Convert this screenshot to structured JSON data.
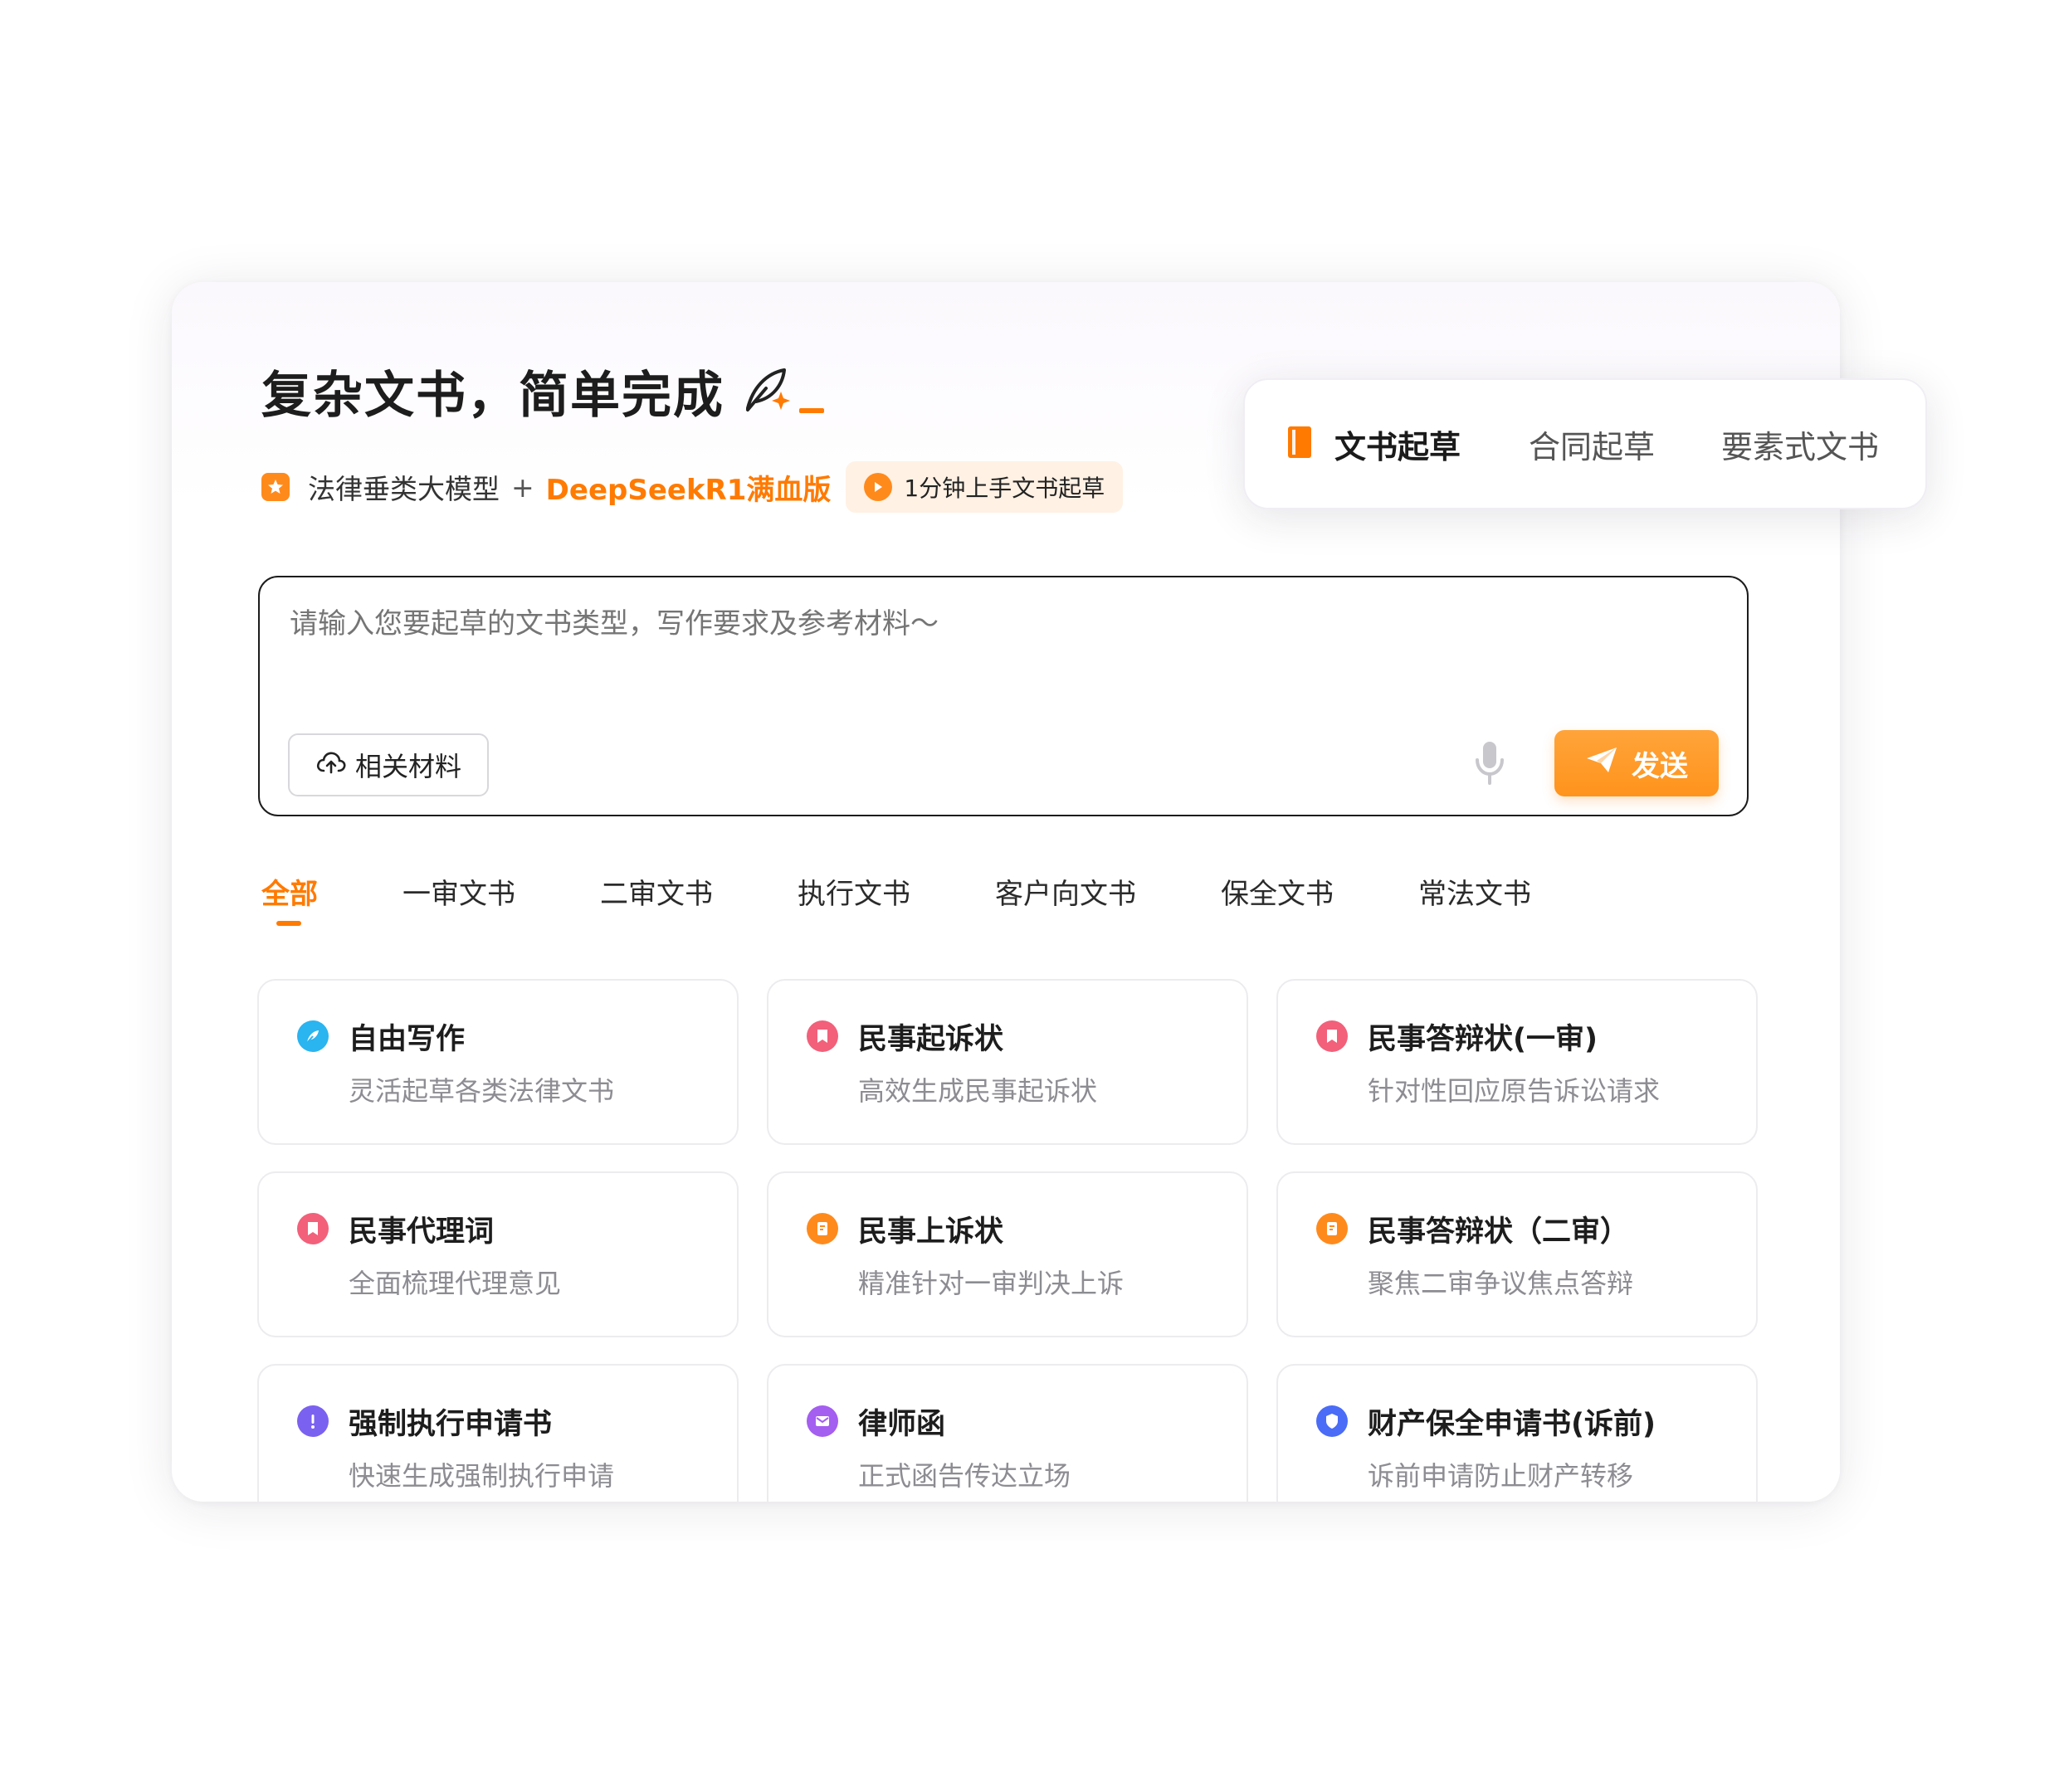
{
  "header": {
    "title": "复杂文书，简单完成",
    "model_label": "法律垂类大模型",
    "plus": "+",
    "deepseek_label": "DeepSeekR1满血版",
    "quick_start": "1分钟上手文书起草"
  },
  "mode_tabs": [
    {
      "label": "文书起草",
      "active": true
    },
    {
      "label": "合同起草",
      "active": false
    },
    {
      "label": "要素式文书",
      "active": false
    }
  ],
  "input": {
    "placeholder": "请输入您要起草的文书类型，写作要求及参考材料～",
    "material_button": "相关材料",
    "send_button": "发送"
  },
  "category_tabs": [
    {
      "label": "全部",
      "active": true
    },
    {
      "label": "一审文书",
      "active": false
    },
    {
      "label": "二审文书",
      "active": false
    },
    {
      "label": "执行文书",
      "active": false
    },
    {
      "label": "客户向文书",
      "active": false
    },
    {
      "label": "保全文书",
      "active": false
    },
    {
      "label": "常法文书",
      "active": false
    }
  ],
  "templates": [
    {
      "title": "自由写作",
      "desc": "灵活起草各类法律文书",
      "icon": "feather-icon",
      "color": "#2ab4f0"
    },
    {
      "title": "民事起诉状",
      "desc": "高效生成民事起诉状",
      "icon": "bookmark-icon",
      "color": "#f2607a"
    },
    {
      "title": "民事答辩状(一审)",
      "desc": "针对性回应原告诉讼请求",
      "icon": "bookmark-icon",
      "color": "#f2607a"
    },
    {
      "title": "民事代理词",
      "desc": "全面梳理代理意见",
      "icon": "bookmark-icon",
      "color": "#f2607a"
    },
    {
      "title": "民事上诉状",
      "desc": "精准针对一审判决上诉",
      "icon": "document-icon",
      "color": "#ff8a1c"
    },
    {
      "title": "民事答辩状（二审）",
      "desc": "聚焦二审争议焦点答辩",
      "icon": "document-icon",
      "color": "#ff8a1c"
    },
    {
      "title": "强制执行申请书",
      "desc": "快速生成强制执行申请",
      "icon": "exclamation-icon",
      "color": "#7b61f0"
    },
    {
      "title": "律师函",
      "desc": "正式函告传达立场",
      "icon": "mail-icon",
      "color": "#a45ef0"
    },
    {
      "title": "财产保全申请书(诉前)",
      "desc": "诉前申请防止财产转移",
      "icon": "shield-icon",
      "color": "#4a6cf7"
    }
  ],
  "colors": {
    "accent": "#ff7a00",
    "send": "#ff931c"
  }
}
